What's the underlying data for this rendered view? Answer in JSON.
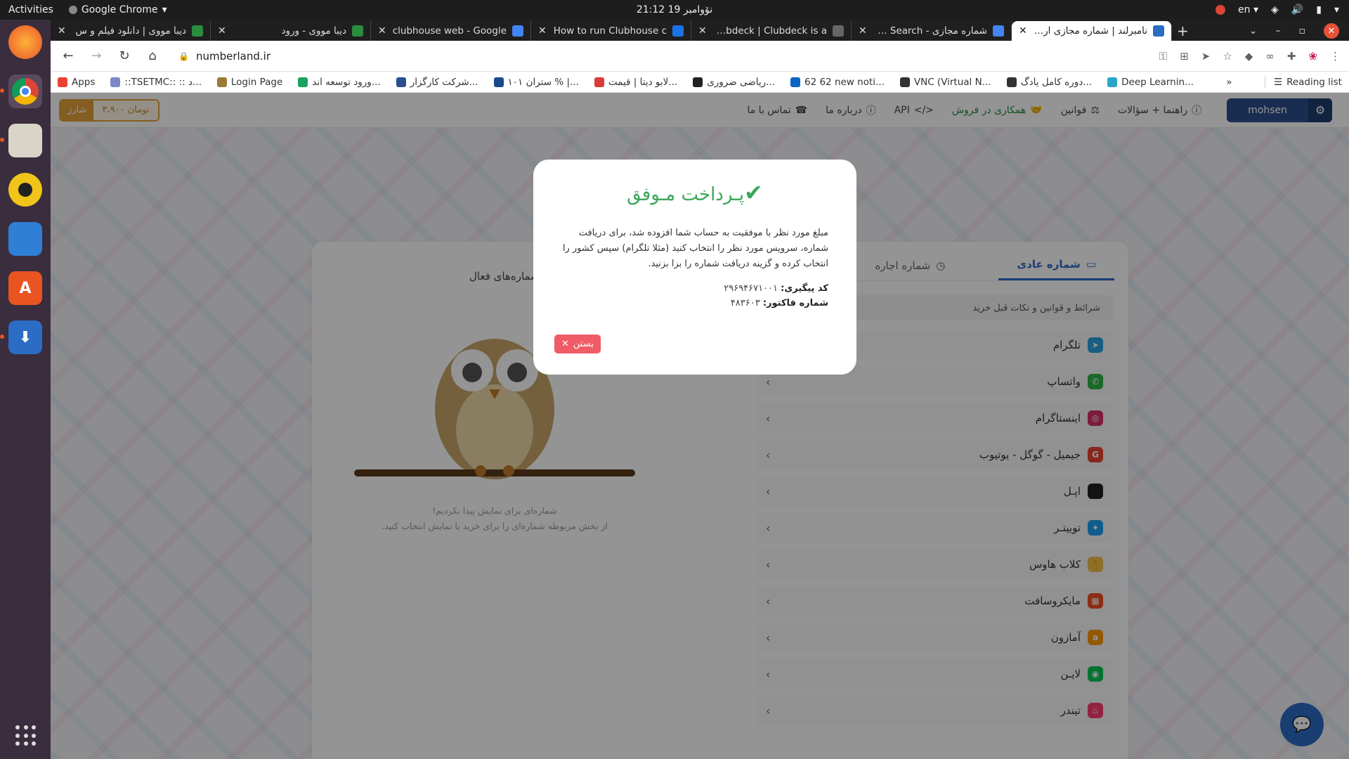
{
  "system": {
    "activities": "Activities",
    "app_name": "Google Chrome",
    "clock": "نۆوامبر 19  21:12",
    "lang": "en"
  },
  "tabs": [
    {
      "title": "دیبا مووی | دانلود فیلم و س",
      "color": "#2a8c3e"
    },
    {
      "title": "دیبا مووی - ورود",
      "color": "#2a8c3e"
    },
    {
      "title": "clubhouse web - Google",
      "color": "#4285f4"
    },
    {
      "title": "How to run Clubhouse c",
      "color": "#1a73e8"
    },
    {
      "title": "Clubdeck | Clubdeck is a",
      "color": "#666666"
    },
    {
      "title": "شماره مجازی - Google Search",
      "color": "#4285f4"
    },
    {
      "title": "نامبرلند | شماره مجازی ارزان",
      "color": "#2b6cc4",
      "active": true
    }
  ],
  "toolbar": {
    "url": "numberland.ir"
  },
  "bookmarks": [
    {
      "label": "Apps",
      "color": "#ea4335"
    },
    {
      "label": "::TSETMC:: :: د...",
      "color": "#7b89c9"
    },
    {
      "label": "Login Page",
      "color": "#9b7b3a"
    },
    {
      "label": "ورود توسعه اند...",
      "color": "#1aa260"
    },
    {
      "label": "شرکت کارگزار...",
      "color": "#2b4f8c"
    },
    {
      "label": "ستران ۱۰۱ % |...",
      "color": "#1b4a8c"
    },
    {
      "label": "لابو دیتا | قیمت...",
      "color": "#d93b3b"
    },
    {
      "label": "ریاضی ضروری...",
      "color": "#222222"
    },
    {
      "label": "62 62 new noti...",
      "color": "#0a66c2"
    },
    {
      "label": "VNC (Virtual N...",
      "color": "#333333"
    },
    {
      "label": "دوره کامل یادگ...",
      "color": "#333333"
    },
    {
      "label": "Deep Learnin...",
      "color": "#2aa5c9"
    }
  ],
  "reading_list": "Reading list",
  "site": {
    "wallet_charge": "شارژ",
    "wallet_balance": "۳،۹۰۰ تومان",
    "nav": [
      {
        "label": "راهنما + سؤالات",
        "green": false
      },
      {
        "label": "قوانین",
        "green": false
      },
      {
        "label": "همکاری در فروش",
        "green": true
      },
      {
        "label": "API",
        "green": false
      },
      {
        "label": "درباره ما",
        "green": false
      },
      {
        "label": "تماس با ما",
        "green": false
      }
    ],
    "username": "mohsen"
  },
  "card": {
    "tab_regular": "شماره عادی",
    "tab_rent": "شماره اجاره",
    "active_numbers": "شماره‌های فعال",
    "terms": "شرائط و قوانین و نکات قبل خرید",
    "services": [
      {
        "name": "تلگرام",
        "color": "#2aa3de"
      },
      {
        "name": "واتساپ",
        "color": "#2fb344"
      },
      {
        "name": "اینستاگرام",
        "color": "#d6306c"
      },
      {
        "name": "جیمیل - گوگل - یوتیوب",
        "color": "#ea4335"
      },
      {
        "name": "اپـل",
        "color": "#222222"
      },
      {
        "name": "توییتـر",
        "color": "#1da1f2"
      },
      {
        "name": "کلاب هاوس",
        "color": "#f2c14e"
      },
      {
        "name": "مایکروسافت",
        "color": "#f25022"
      },
      {
        "name": "آمازون",
        "color": "#ff9900"
      },
      {
        "name": "لایـن",
        "color": "#06c755"
      },
      {
        "name": "تیندر",
        "color": "#fe3c72"
      }
    ],
    "empty_line1": "شماره‌ای برای نمایش پیدا نکردیم!",
    "empty_line2": "از بخش مربوطه شماره‌ای را برای خرید یا نمایش انتخاب کنید."
  },
  "modal": {
    "title": "پـرداخت مـوفق",
    "message": "مبلغ مورد نظر با موفقیت به حساب شما افزوده شد، برای دریافت شماره، سرویس مورد نظر را انتخاب کنید (مثلا تلگرام) سپس کشور را انتخاب کرده و گزینه دریافت شماره را بزا بزنید.",
    "tracking_label": "کد پیگیری:",
    "tracking_value": "۲۹۶۹۴۶۷۱۰۰۱",
    "invoice_label": "شماره فاکتور:",
    "invoice_value": "۴۸۳۶۰۳",
    "close_label": "بستن"
  }
}
